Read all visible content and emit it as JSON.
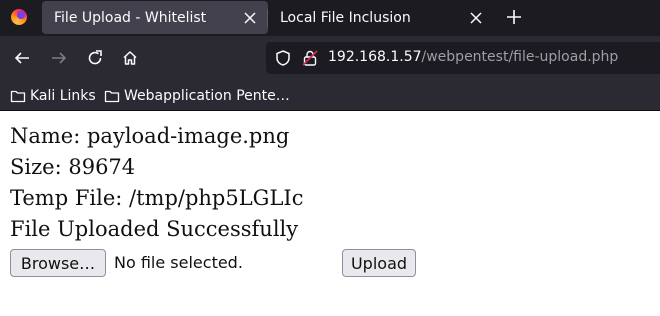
{
  "browser": {
    "tabs": [
      {
        "title": "File Upload - Whitelist",
        "active": true
      },
      {
        "title": "Local File Inclusion",
        "active": false
      }
    ],
    "url": {
      "host": "192.168.1.57",
      "path": "/webpentest/file-upload.php"
    },
    "bookmarks": [
      {
        "label": "Kali Links",
        "icon": "folder-icon"
      },
      {
        "label": "Webapplication Pente…",
        "icon": "folder-icon"
      }
    ],
    "colors": {
      "tab_strip": "#1c1b22",
      "toolbar": "#2b2a33",
      "active_tab": "#42414d"
    }
  },
  "page": {
    "name_line": "Name: payload-image.png",
    "size_line": "Size: 89674",
    "temp_line": "Temp File: /tmp/php5LGLIc",
    "status_line": "File Uploaded Successfully",
    "browse_label": "Browse…",
    "file_status": "No file selected.",
    "upload_label": "Upload"
  }
}
